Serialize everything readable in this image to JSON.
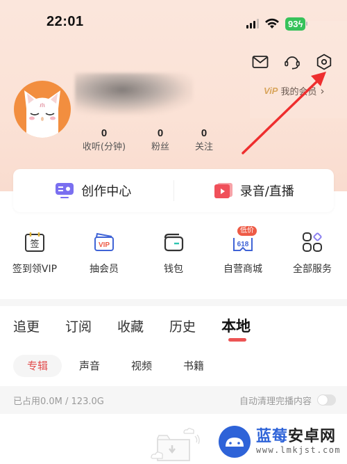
{
  "status_bar": {
    "time": "22:01",
    "battery": "93",
    "icons": [
      "signal-icon",
      "wifi-icon",
      "battery-charging-icon"
    ]
  },
  "header": {
    "icons": [
      "mail-icon",
      "headset-icon",
      "settings-icon"
    ],
    "vip_logo": "ViP",
    "vip_link": "我的会员",
    "vip_chevron": "›"
  },
  "profile": {
    "avatar": "cat-avatar",
    "username": "",
    "stats": [
      {
        "value": "0",
        "label": "收听(分钟)"
      },
      {
        "value": "0",
        "label": "粉丝"
      },
      {
        "value": "0",
        "label": "关注"
      }
    ]
  },
  "creation_card": {
    "left": {
      "label": "创作中心",
      "icon": "creator-center-icon",
      "color": "#7a6ff0"
    },
    "right": {
      "label": "录音/直播",
      "icon": "record-live-icon",
      "color": "#f0505a"
    }
  },
  "services": [
    {
      "label": "签到领VIP",
      "icon": "sign-in-calendar-icon",
      "glyph": "签"
    },
    {
      "label": "抽会员",
      "icon": "vip-card-icon",
      "glyph": "VIP"
    },
    {
      "label": "钱包",
      "icon": "wallet-icon"
    },
    {
      "label": "自营商城",
      "icon": "mall-618-icon",
      "glyph": "618",
      "badge": "低价"
    },
    {
      "label": "全部服务",
      "icon": "all-services-grid-icon"
    }
  ],
  "tabs": [
    {
      "label": "追更",
      "active": false
    },
    {
      "label": "订阅",
      "active": false
    },
    {
      "label": "收藏",
      "active": false
    },
    {
      "label": "历史",
      "active": false
    },
    {
      "label": "本地",
      "active": true
    }
  ],
  "subtabs": [
    {
      "label": "专辑",
      "active": true
    },
    {
      "label": "声音",
      "active": false
    },
    {
      "label": "视频",
      "active": false
    },
    {
      "label": "书籍",
      "active": false
    }
  ],
  "storage": {
    "used_text": "已占用0.0M / 123.0G",
    "auto_clean_label": "自动清理完播内容",
    "auto_clean_on": false
  },
  "watermark": {
    "title_blue": "蓝莓",
    "title_dark": "安卓网",
    "url": "www.lmkjst.com"
  },
  "colors": {
    "accent_red": "#ec5454",
    "hero_bg": "#fbe4d8",
    "battery_green": "#36c25a",
    "avatar_orange": "#f28e3f",
    "vip_gold": "#d9a55c"
  }
}
